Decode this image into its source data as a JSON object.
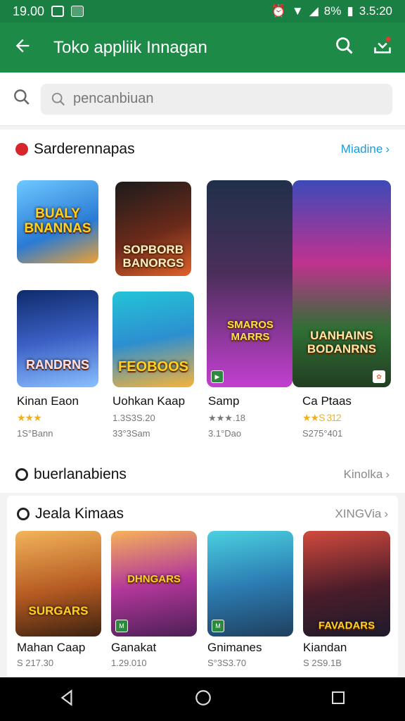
{
  "status": {
    "time": "19.00",
    "battery": "8%",
    "clock_right": "3.5:20"
  },
  "appbar": {
    "title": "Toko appliik Innagan"
  },
  "search": {
    "placeholder": "pencanbiuan"
  },
  "section1": {
    "title": "Sarderennapas",
    "more": "Miadine",
    "tiles": [
      {
        "label": "BUALY\nBNANNAS"
      },
      {
        "label": "SOPBORB\nBANORGS"
      },
      {
        "label": "RANDRNS"
      },
      {
        "label": "FEOBOOS"
      },
      {
        "label": "SMAROS\nMARRS"
      },
      {
        "label": "UANHAINS\nBODANRNS"
      }
    ],
    "apps": [
      {
        "name": "Kinan Eaon",
        "meta1": "",
        "stars": "★★★",
        "meta2": "1S°Bann"
      },
      {
        "name": "Uohkan Kaap",
        "meta1": "1.3S3S.20",
        "stars": "",
        "meta2": "33°3Sam"
      },
      {
        "name": "Samp",
        "meta1": "★★★.18",
        "stars": "",
        "meta2": "3.1°Dao"
      },
      {
        "name": "Ca Ptaas",
        "meta1": "",
        "stars": "★★S 312",
        "meta2": "S275°401"
      }
    ]
  },
  "section2": {
    "title": "buerlanabiens",
    "more": "Kinolka"
  },
  "section3": {
    "title": "Jeala Kimaas",
    "more": "XINGVia",
    "tiles": [
      {
        "label": "SURGARS"
      },
      {
        "label": "DHNGARS"
      },
      {
        "label": ""
      },
      {
        "label": "FAVADARS"
      }
    ],
    "apps": [
      {
        "name": "Mahan Caap",
        "meta": "S 217.30"
      },
      {
        "name": "Ganakat",
        "meta": "1.29.010"
      },
      {
        "name": "Gnimanes",
        "meta": "S°3S3.70"
      },
      {
        "name": "Kiandan",
        "meta": "S 2S9.1B"
      }
    ]
  },
  "colors": {
    "primary": "#1e8a48",
    "accent": "#1a9bd7"
  }
}
